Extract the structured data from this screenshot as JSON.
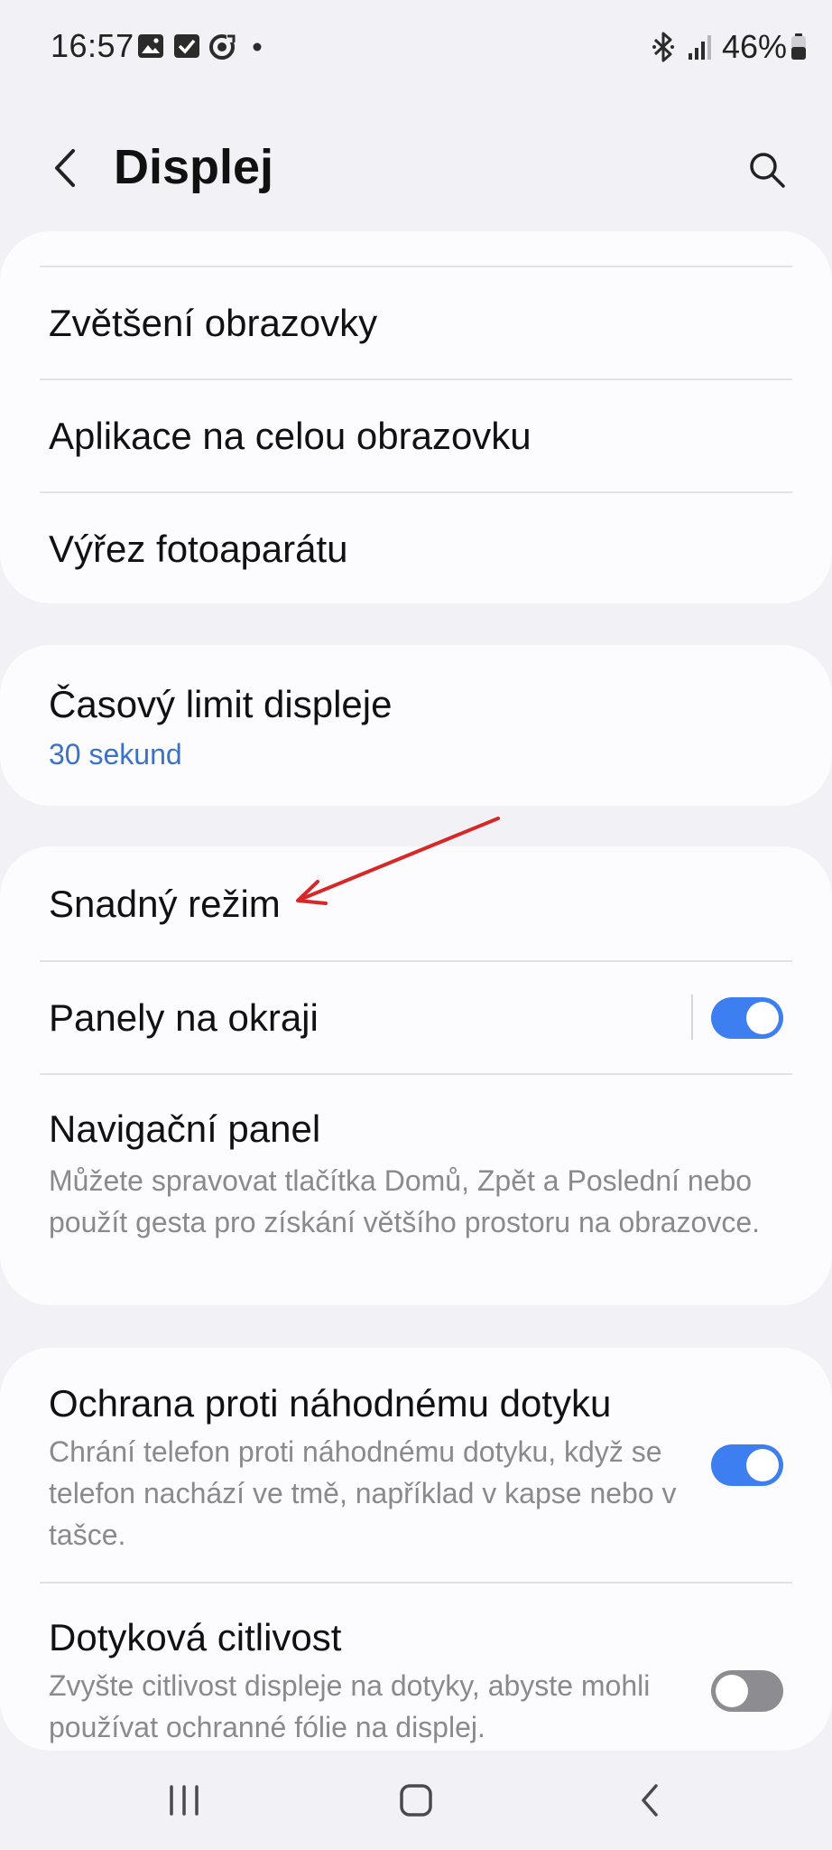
{
  "status_bar": {
    "time": "16:57",
    "battery": "46%",
    "left_icons": [
      "gallery-icon",
      "checkbox-icon",
      "sync-icon",
      "dot-icon"
    ],
    "right_icons": [
      "bluetooth-icon",
      "signal-icon",
      "battery-icon"
    ]
  },
  "header": {
    "title": "Displej",
    "back_icon": "back-chevron-icon",
    "search_icon": "search-icon"
  },
  "card1": {
    "items": [
      {
        "label": "Zvětšení obrazovky"
      },
      {
        "label": "Aplikace na celou obrazovku"
      },
      {
        "label": "Výřez fotoaparátu"
      }
    ]
  },
  "card2": {
    "title": "Časový limit displeje",
    "value": "30 sekund"
  },
  "card3": {
    "easy_mode": "Snadný režim",
    "edge_panels": {
      "label": "Panely na okraji",
      "enabled": true
    },
    "navigation": {
      "title": "Navigační panel",
      "description": "Můžete spravovat tlačítka Domů, Zpět a Poslední nebo použít gesta pro získání většího prostoru na obrazovce."
    }
  },
  "card4": {
    "accidental_touch": {
      "title": "Ochrana proti náhodnému dotyku",
      "description": "Chrání telefon proti náhodnému dotyku, když se telefon nachází ve tmě, například v kapse nebo v tašce.",
      "enabled": true
    },
    "touch_sensitivity": {
      "title": "Dotyková citlivost",
      "description": "Zvyšte citlivost displeje na dotyky, abyste mohli používat ochranné fólie na displej.",
      "enabled": false
    }
  },
  "colors": {
    "accent": "#3d7ef0",
    "link": "#3c72c6",
    "annotation_arrow": "#d62828",
    "background": "#f2f2f6",
    "card": "#fcfcfe"
  },
  "nav_bar": {
    "icons": [
      "recents-icon",
      "home-icon",
      "back-icon"
    ]
  }
}
